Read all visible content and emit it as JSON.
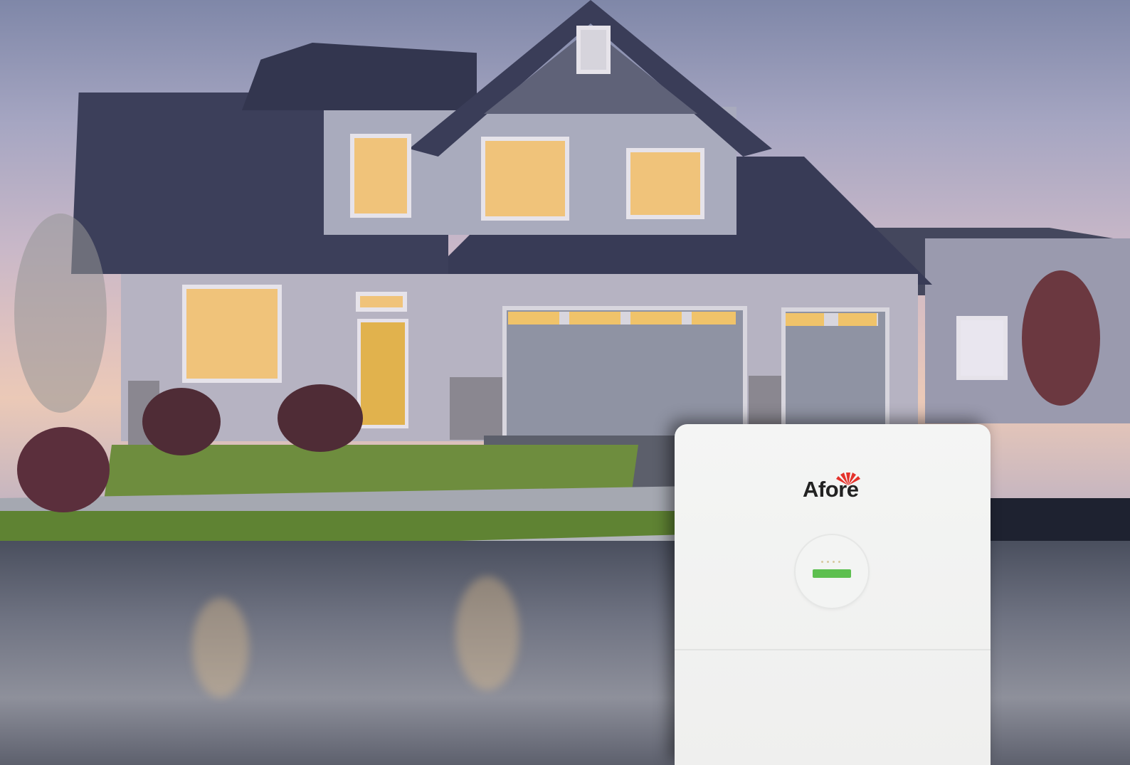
{
  "photo": {
    "subject": "house",
    "brand": {
      "logo_text": "Afore",
      "display_text": "",
      "side_label": ""
    },
    "colors": {
      "brand_sun": "#e4322b",
      "display_green": "#5dbf4f",
      "device_body": "#f2f3f2"
    },
    "icons": [
      "afore-logo-icon",
      "sun-rays-icon"
    ]
  }
}
